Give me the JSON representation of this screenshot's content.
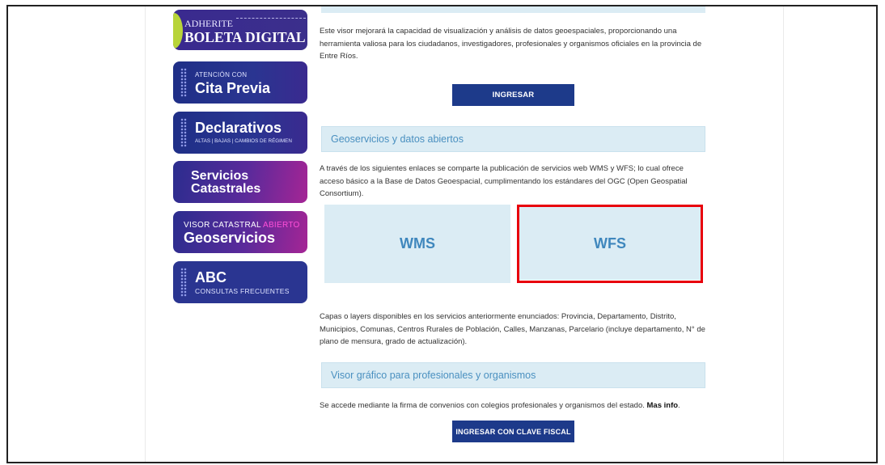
{
  "sidebar": {
    "boleta": {
      "small": "ADHERITE",
      "big": "BOLETA DIGITAL"
    },
    "cita": {
      "small": "ATENCIÓN CON",
      "big": "Cita Previa"
    },
    "declarativos": {
      "big": "Declarativos",
      "small": "ALTAS | BAJAS | CAMBIOS DE RÉGIMEN"
    },
    "servicios": {
      "line1": "Servicios",
      "line2": "Catastrales"
    },
    "visor": {
      "small_a": "VISOR CATASTRAL",
      "small_b": "ABIERTO",
      "big": "Geoservicios"
    },
    "abc": {
      "big": "ABC",
      "small": "CONSULTAS FRECUENTES"
    }
  },
  "visor_intro": {
    "text": "Este visor mejorará la capacidad de visualización y análisis de datos geoespaciales, proporcionando una herramienta valiosa para los ciudadanos, investigadores, profesionales y organismos oficiales en la provincia de Entre Ríos.",
    "button": "INGRESAR"
  },
  "geoservicios": {
    "heading": "Geoservicios y datos abiertos",
    "text": "A través de los siguientes enlaces se comparte la publicación de servicios web WMS y WFS; lo cual ofrece acceso básico a la Base de Datos Geoespacial, cumplimentando los estándares del OGC (Open Geospatial Consortium).",
    "tile_wms": "WMS",
    "tile_wfs": "WFS",
    "layers_text": "Capas o layers disponibles en los servicios anteriormente enunciados: Provincia, Departamento, Distrito, Municipios, Comunas, Centros Rurales de Población, Calles, Manzanas, Parcelario (incluye departamento, N° de plano de mensura, grado de actualización)."
  },
  "visor_grafico": {
    "heading": "Visor gráfico para profesionales y organismos",
    "text": "Se accede mediante la firma de convenios con colegios profesionales y organismos del estado.",
    "more_link": "Mas info",
    "button": "INGRESAR CON CLAVE FISCAL"
  },
  "colors": {
    "highlight": "#e8000b",
    "button": "#1d3a8a",
    "section_bg": "#dbecf4",
    "section_text": "#4a90c0"
  }
}
